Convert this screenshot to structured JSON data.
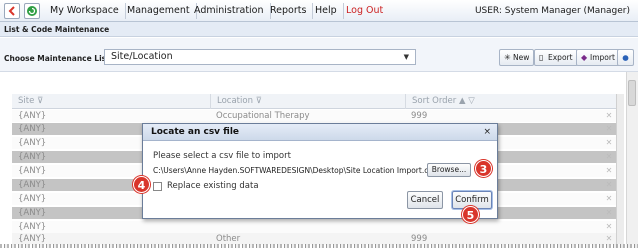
{
  "nav": {
    "items": [
      "My Workspace",
      "Management",
      "Administration",
      "Reports",
      "Help",
      "Log Out"
    ],
    "user": "USER: System Manager (Manager)"
  },
  "section": {
    "title": "List & Code Maintenance"
  },
  "toolbar": {
    "choose_label": "Choose Maintenance List:",
    "selected_list": "Site/Location",
    "new_label": "New",
    "export_label": "Export",
    "import_label": "Import"
  },
  "grid": {
    "headers": [
      "Site",
      "Location",
      "Sort Order"
    ],
    "rows": [
      [
        "{ANY}",
        "Occupational Therapy",
        "999"
      ],
      [
        "{ANY}",
        "",
        ""
      ],
      [
        "{ANY}",
        "",
        ""
      ],
      [
        "{ANY}",
        "",
        ""
      ],
      [
        "{ANY}",
        "",
        ""
      ],
      [
        "{ANY}",
        "",
        ""
      ],
      [
        "{ANY}",
        "",
        ""
      ],
      [
        "{ANY}",
        "",
        ""
      ],
      [
        "{ANY}",
        "",
        ""
      ],
      [
        "{ANY}",
        "Other",
        "999"
      ]
    ]
  },
  "dialog": {
    "title": "Locate an csv file",
    "prompt": "Please select a csv file to import",
    "file_path": "C:\\Users\\Anne Hayden.SOFTWAREDESIGN\\Desktop\\Site Location Import.csv",
    "browse_label": "Browse...",
    "replace_label": "Replace existing data",
    "replace_checked": false,
    "cancel_label": "Cancel",
    "confirm_label": "Confirm",
    "close_glyph": "×"
  },
  "callouts": [
    "3",
    "4",
    "5"
  ],
  "colors": {
    "callout": "#d9352b",
    "logout": "#cc2222",
    "alt_row": "#c4c4c4"
  }
}
